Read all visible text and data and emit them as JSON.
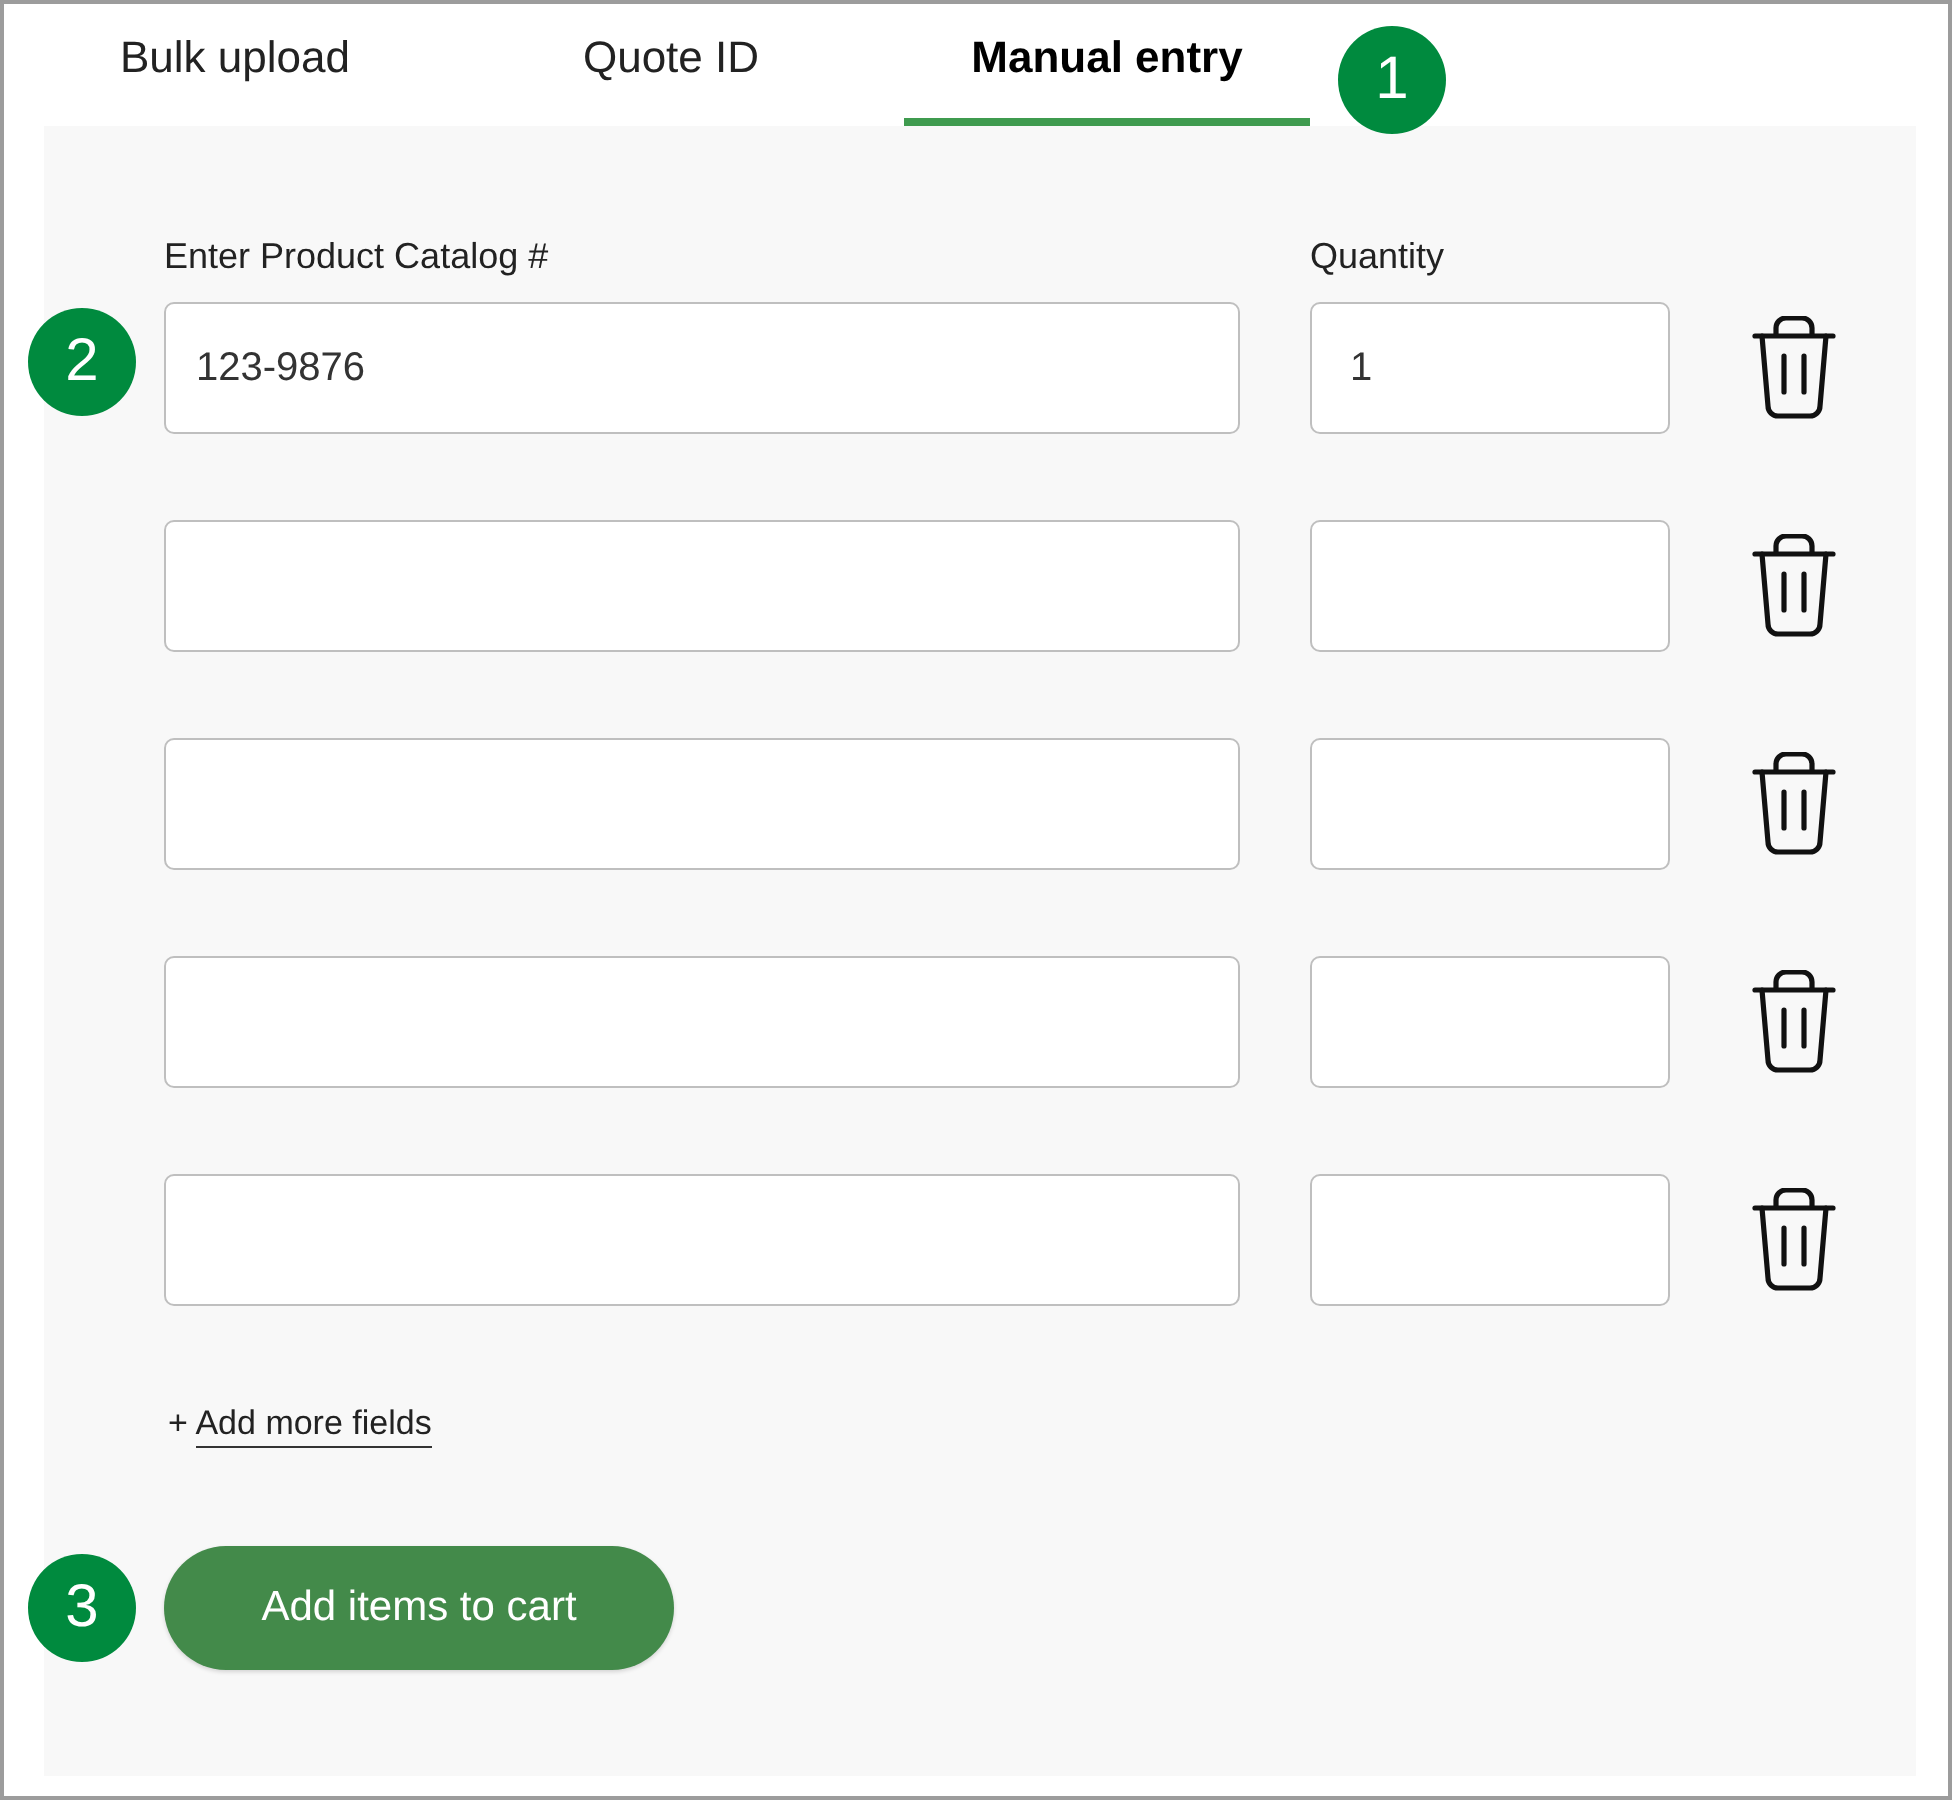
{
  "tab_bar": {
    "tabs": [
      {
        "label": "Bulk upload",
        "selected": false
      },
      {
        "label": "Quote ID",
        "selected": false
      },
      {
        "label": "Manual entry",
        "selected": true
      }
    ],
    "callout": "1"
  },
  "form": {
    "catalog_label": "Enter Product Catalog #",
    "quantity_label": "Quantity",
    "rows": [
      {
        "callout": "2",
        "catalog_value": "123-9876",
        "quantity_value": "1"
      },
      {},
      {},
      {},
      {}
    ],
    "add_more_link": {
      "prefix": "+",
      "label": "Add more fields"
    },
    "submit_button": {
      "label": "Add items to cart",
      "callout": "3"
    }
  }
}
